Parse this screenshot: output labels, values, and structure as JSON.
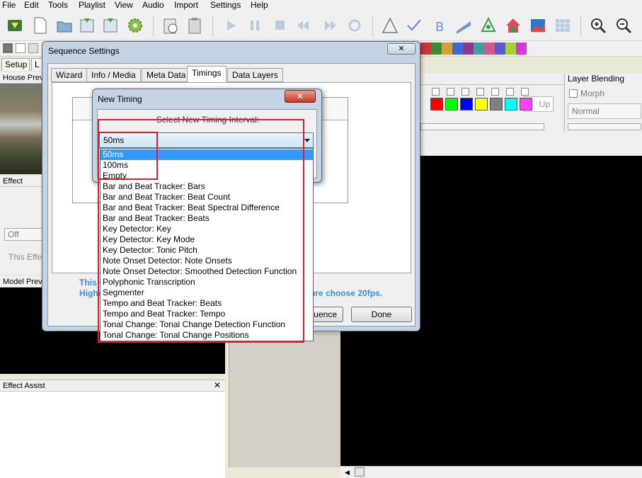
{
  "menu": [
    "File",
    "Edit",
    "Tools",
    "Playlist",
    "View",
    "Audio",
    "Import",
    "Settings",
    "Help"
  ],
  "main_tabs": [
    "Setup",
    "L"
  ],
  "left_panes": {
    "house_preview": "House Prev",
    "effect": "Effect",
    "effect_off": "Off",
    "effect_note": "This Effe",
    "model_preview": "Model Prev",
    "effect_assist": "Effect Assist"
  },
  "layer_blending": {
    "title": "Layer Blending",
    "morph": "Morph",
    "mode": "Normal"
  },
  "palette_button": "Up",
  "palette_colors": [
    "#ff0000",
    "#00ff00",
    "#0000ff",
    "#ffff00",
    "#808080",
    "#00ffff",
    "#ff40ff"
  ],
  "sequence_settings": {
    "title": "Sequence Settings",
    "tabs": [
      "Wizard",
      "Info / Media",
      "Meta Data",
      "Timings",
      "Data Layers"
    ],
    "active_tab": "Timings",
    "note_line1": "This c",
    "note_line2": "Highe",
    "note_right": "ure choose 20fps.",
    "btn_sequence": "uence",
    "btn_done": "Done"
  },
  "new_timing": {
    "title": "New Timing",
    "label": "Select New Timing Interval:",
    "selected": "50ms",
    "options": [
      "50ms",
      "100ms",
      "Empty",
      "Bar and Beat Tracker: Bars",
      "Bar and Beat Tracker: Beat Count",
      "Bar and Beat Tracker: Beat Spectral Difference",
      "Bar and Beat Tracker: Beats",
      "Key Detector: Key",
      "Key Detector: Key Mode",
      "Key Detector: Tonic Pitch",
      "Note Onset Detector: Note Onsets",
      "Note Onset Detector: Smoothed Detection Function",
      "Polyphonic Transcription",
      "Segmenter",
      "Tempo and Beat Tracker: Beats",
      "Tempo and Beat Tracker: Tempo",
      "Tonal Change: Tonal Change Detection Function",
      "Tonal Change: Tonal Change Positions"
    ]
  },
  "colors": {
    "accent": "#3399ff",
    "annotation": "#e01e2b"
  }
}
